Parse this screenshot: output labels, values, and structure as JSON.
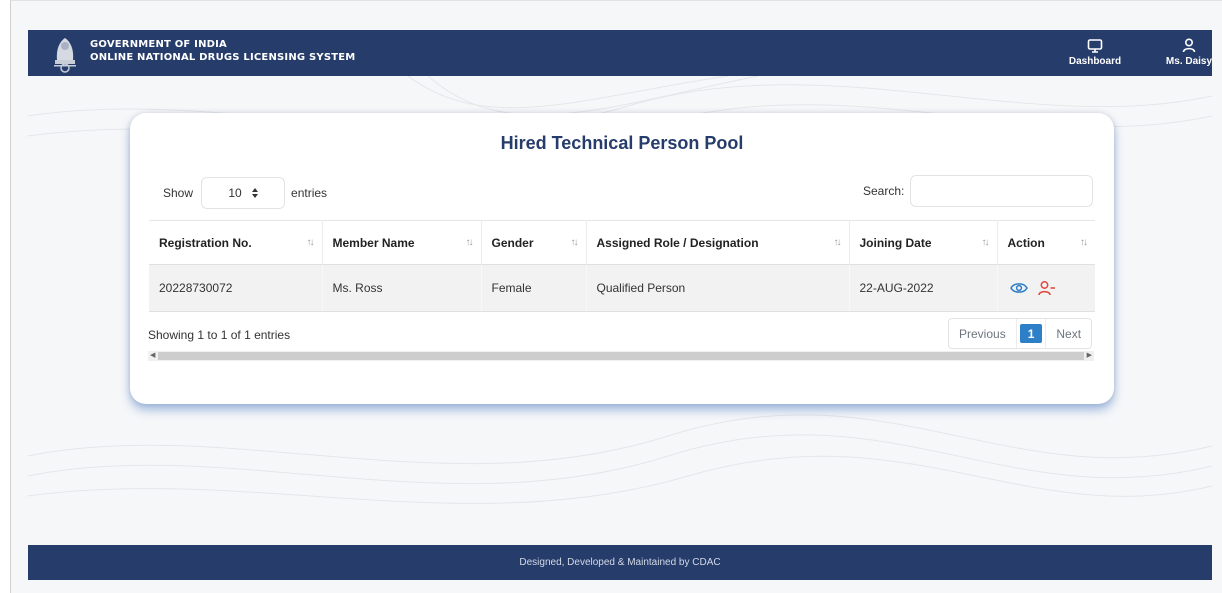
{
  "header": {
    "brand_line1": "GOVERNMENT OF INDIA",
    "brand_line2": "ONLINE NATIONAL DRUGS LICENSING SYSTEM",
    "nav": {
      "dashboard": "Dashboard",
      "user": "Ms. Daisy"
    }
  },
  "card": {
    "title": "Hired Technical Person Pool",
    "length": {
      "show_label": "Show",
      "value": "10",
      "entries_label": "entries"
    },
    "search": {
      "label": "Search:",
      "value": ""
    },
    "table": {
      "columns": [
        "Registration No.",
        "Member Name",
        "Gender",
        "Assigned Role / Designation",
        "Joining Date",
        "Action"
      ],
      "rows": [
        {
          "registration_no": "20228730072",
          "member_name": "Ms. Ross",
          "gender": "Female",
          "role": "Qualified Person",
          "joining_date": "22-AUG-2022",
          "actions": [
            "eye-icon",
            "remove-user-icon"
          ]
        }
      ]
    },
    "info": "Showing 1 to 1 of 1 entries",
    "pagination": {
      "previous": "Previous",
      "current": "1",
      "next": "Next"
    }
  },
  "footer": {
    "text": "Designed, Developed & Maintained by CDAC"
  },
  "colors": {
    "header_bg": "#263c6b",
    "title": "#263c6b",
    "view_icon": "#2d7fc7",
    "remove_icon": "#e0453a",
    "active_page": "#2d7fc7"
  }
}
